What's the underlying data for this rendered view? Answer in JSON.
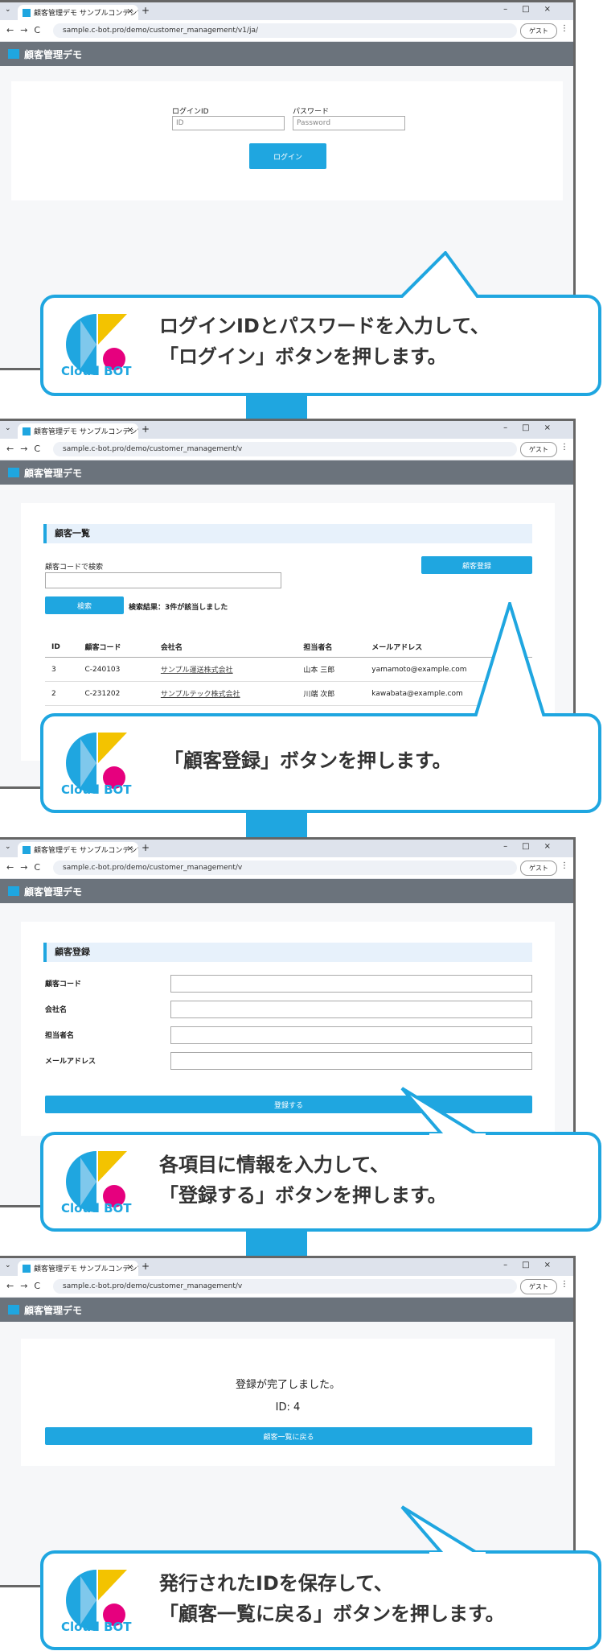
{
  "browser": {
    "tab_title": "顧客管理デモ サンプルコンテンツ | ",
    "url_full": "sample.c-bot.pro/demo/customer_management/v1/ja/",
    "url_short": "sample.c-bot.pro/demo/customer_management/v",
    "guest_label": "ゲスト",
    "new_tab": "+",
    "close": "×",
    "win_controls": "–□×"
  },
  "app_title": "顧客管理デモ",
  "brand": {
    "logo_text": "Cloud BOT",
    "accent": "#1fa6e0",
    "pink": "#e6007e",
    "yellow": "#f3c300"
  },
  "step1": {
    "login_id_label": "ログインID",
    "login_id_placeholder": "ID",
    "password_label": "パスワード",
    "password_placeholder": "Password",
    "login_button": "ログイン",
    "callout_line1": "ログインIDとパスワードを入力して、",
    "callout_line2": "「ログイン」ボタンを押します。"
  },
  "step2": {
    "section_title": "顧客一覧",
    "search_label": "顧客コードで検索",
    "search_button": "検索",
    "result_text": "検索結果：3件が該当しました",
    "register_button": "顧客登録",
    "columns": [
      "ID",
      "顧客コード",
      "会社名",
      "担当者名",
      "メールアドレス"
    ],
    "rows": [
      [
        "3",
        "C-240103",
        "サンプル運送株式会社",
        "山本 三郎",
        "yamamoto@example.com"
      ],
      [
        "2",
        "C-231202",
        "サンプルテック株式会社",
        "川端 次郎",
        "kawabata@example.com"
      ]
    ],
    "callout_line1": "「顧客登録」ボタンを押します。"
  },
  "step3": {
    "section_title": "顧客登録",
    "field_code": "顧客コード",
    "field_company": "会社名",
    "field_person": "担当者名",
    "field_email": "メールアドレス",
    "submit_button": "登録する",
    "callout_line1": "各項目に情報を入力して、",
    "callout_line2": "「登録する」ボタンを押します。"
  },
  "step4": {
    "done_message": "登録が完了しました。",
    "id_text": "ID: 4",
    "back_button": "顧客一覧に戻る",
    "callout_line1": "発行されたIDを保存して、",
    "callout_line2": "「顧客一覧に戻る」ボタンを押します。"
  }
}
